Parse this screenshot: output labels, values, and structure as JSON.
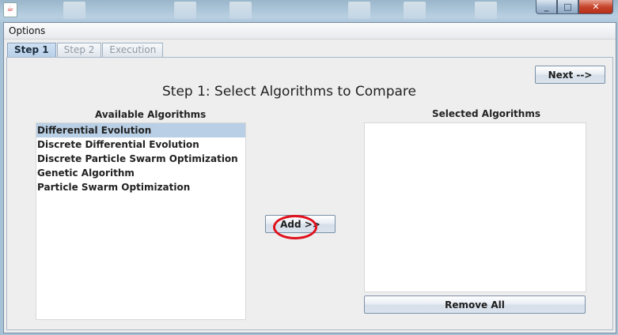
{
  "window": {
    "app_icon": "java-icon",
    "controls": {
      "minimize": "_",
      "maximize": "□",
      "close": "✕"
    }
  },
  "menubar": {
    "items": [
      "Options"
    ]
  },
  "tabs": [
    {
      "label": "Step 1",
      "active": true
    },
    {
      "label": "Step 2",
      "active": false
    },
    {
      "label": "Execution",
      "active": false
    }
  ],
  "step1": {
    "title": "Step 1: Select Algorithms to Compare",
    "next_button": "Next -->",
    "available_header": "Available Algorithms",
    "available": [
      "Differential Evolution",
      "Discrete Differential Evolution",
      "Discrete Particle Swarm Optimization",
      "Genetic Algorithm",
      "Particle Swarm Optimization"
    ],
    "selected_item": "Differential Evolution",
    "add_button": "Add >>",
    "selected_header": "Selected Algorithms",
    "selected": [],
    "remove_all_button": "Remove All"
  },
  "colors": {
    "selection": "#b8cfe5",
    "annotation": "#e0101c"
  }
}
